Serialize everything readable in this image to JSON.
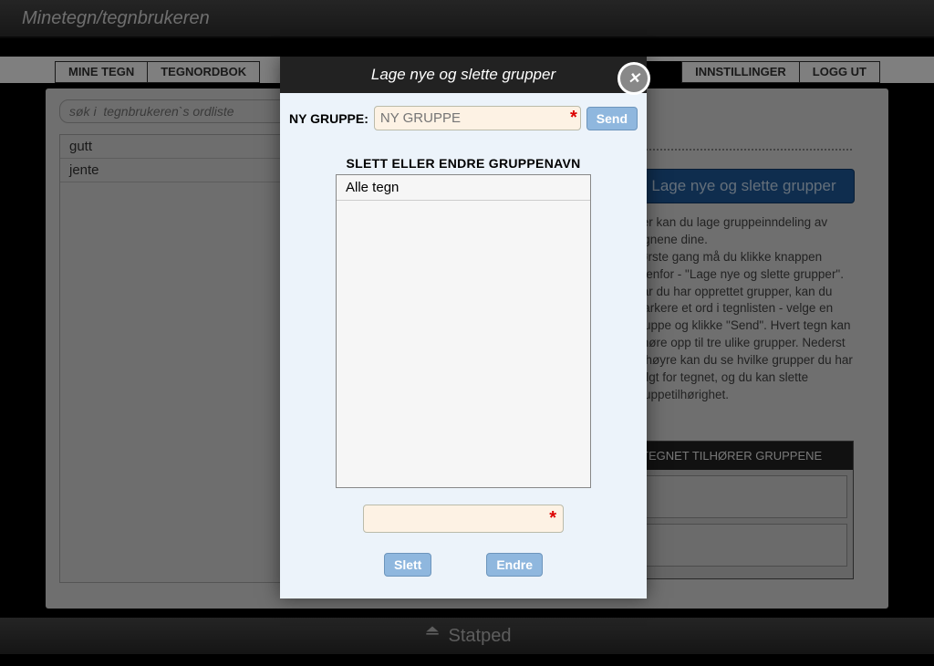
{
  "header": {
    "title": "Minetegn/tegnbrukeren"
  },
  "tabs": {
    "left": [
      "MINE TEGN",
      "TEGNORDBOK"
    ],
    "right": [
      "INNSTILLINGER",
      "LOGG UT"
    ]
  },
  "search": {
    "placeholder": "søk i  tegnbrukeren`s ordliste"
  },
  "word_list": [
    "gutt",
    "jente"
  ],
  "sidebar": {
    "dot_divider": true,
    "manage_groups_button": "Lage nye og slette grupper",
    "help_text": "Her kan du lage gruppeinndeling av tegnene dine.\nFørste gang må du klikke knappen ovenfor - \"Lage nye og slette grupper\".\nNår du har opprettet grupper, kan du markere et ord i tegnlisten - velge en gruppe og klikke \"Send\". Hvert tegn kan tilhøre opp til tre ulike grupper. Nederst til høyre kan du se hvilke grupper du har valgt for tegnet, og du kan slette gruppetilhørighet.",
    "panel_title": "TEGNET TILHØRER GRUPPENE"
  },
  "modal": {
    "title": "Lage nye og slette grupper",
    "new_group_label": "NY GRUPPE:",
    "new_group_placeholder": "NY GRUPPE",
    "send_button": "Send",
    "list_title": "SLETT ELLER ENDRE GRUPPENAVN",
    "groups": [
      "Alle tegn"
    ],
    "edit_value": "",
    "delete_button": "Slett",
    "rename_button": "Endre"
  },
  "footer": {
    "brand": "Statped"
  }
}
